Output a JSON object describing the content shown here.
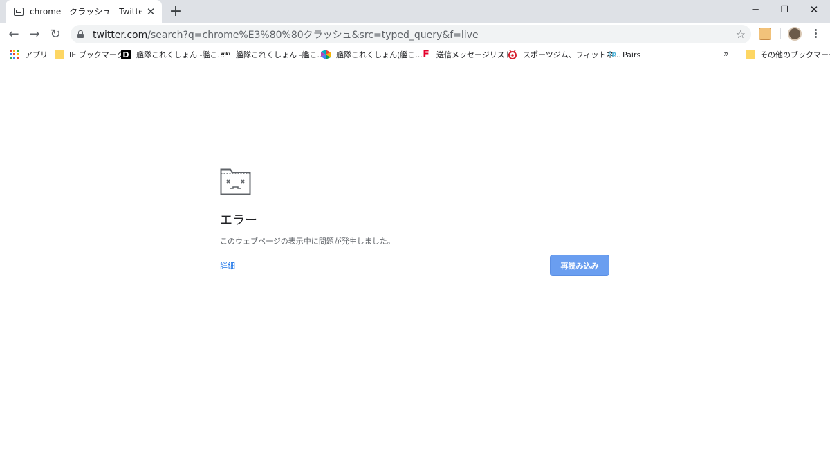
{
  "tab": {
    "title": "chrome　クラッシュ - Twitter検索 / Tw",
    "close_icon": "close-icon",
    "new_tab_icon": "plus-icon"
  },
  "window_controls": {
    "minimize": "─",
    "restore": "❐",
    "close": "✕"
  },
  "toolbar": {
    "back": "←",
    "forward": "→",
    "reload": "↻",
    "url_host": "twitter.com",
    "url_path": "/search?q=chrome%E3%80%80クラッシュ&src=typed_query&f=live",
    "star": "☆"
  },
  "bookmarks": [
    {
      "label": "アプリ",
      "icon": "apps-grid-icon"
    },
    {
      "label": "IE ブックマーク",
      "icon": "folder-icon"
    },
    {
      "label": "艦隊これくしょん -艦こ...",
      "icon": "d-logo-icon"
    },
    {
      "label": "艦隊これくしょん -艦こ...",
      "icon": "wiki-logo-icon"
    },
    {
      "label": "艦隊これくしょん(艦こ...",
      "icon": "colorful-logo-icon"
    },
    {
      "label": "送信メッセージリスト",
      "icon": "f-logo-icon"
    },
    {
      "label": "スポーツジム、フィットネ...",
      "icon": "gym-logo-icon"
    },
    {
      "label": "Pairs",
      "icon": "pairs-logo-icon"
    }
  ],
  "bookmarks_overflow": "»",
  "other_bookmarks": "その他のブックマーク",
  "error": {
    "title": "エラー",
    "message": "このウェブページの表示中に問題が発生しました。",
    "details": "詳細",
    "reload_button": "再読み込み"
  },
  "colors": {
    "tabstrip": "#dee1e6",
    "omnibox": "#f1f3f4",
    "link": "#1a73e8",
    "button": "#6a9ef0"
  }
}
